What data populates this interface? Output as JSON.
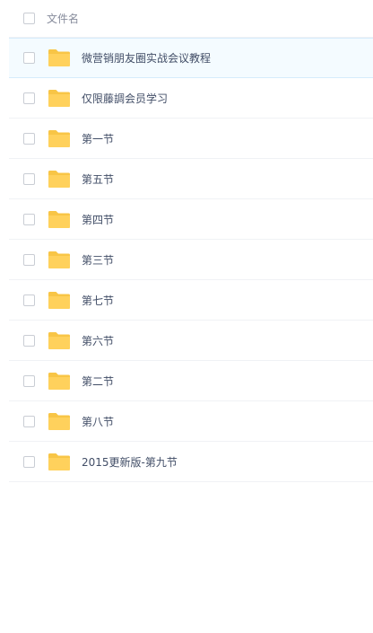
{
  "header": {
    "column_label": "文件名"
  },
  "files": [
    {
      "name": "微营销朋友圈实战会议教程",
      "icon": "folder-icon",
      "selected": true
    },
    {
      "name": "仅限藤調会员学习",
      "icon": "folder-icon"
    },
    {
      "name": "第一节",
      "icon": "folder-icon"
    },
    {
      "name": "第五节",
      "icon": "folder-icon"
    },
    {
      "name": "第四节",
      "icon": "folder-icon"
    },
    {
      "name": "第三节",
      "icon": "folder-icon"
    },
    {
      "name": "第七节",
      "icon": "folder-icon"
    },
    {
      "name": "第六节",
      "icon": "folder-icon"
    },
    {
      "name": "第二节",
      "icon": "folder-icon"
    },
    {
      "name": "第八节",
      "icon": "folder-icon"
    },
    {
      "name": "2015更新版-第九节",
      "icon": "folder-icon"
    }
  ],
  "colors": {
    "folder": "#ffd15c",
    "folder_tab": "#f8c546",
    "selected_row": "#f4fbff"
  }
}
